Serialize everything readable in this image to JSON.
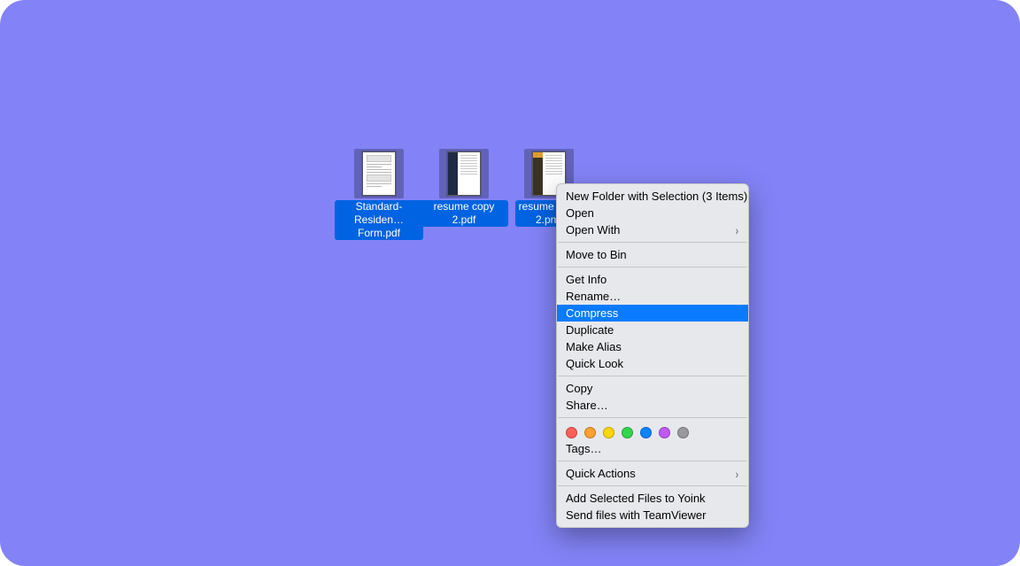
{
  "files": [
    {
      "label": "Standard-\nResiden…Form.pdf",
      "style": "form"
    },
    {
      "label": "resume copy 2.pdf",
      "style": "resume-blue"
    },
    {
      "label": "resume copy\n2.png",
      "style": "resume-orange"
    }
  ],
  "menu": {
    "highlighted": "compress",
    "items": {
      "new_folder_with_selection": "New Folder with Selection (3 Items)",
      "open": "Open",
      "open_with": "Open With",
      "move_to_bin": "Move to Bin",
      "get_info": "Get Info",
      "rename": "Rename…",
      "compress": "Compress",
      "duplicate": "Duplicate",
      "make_alias": "Make Alias",
      "quick_look": "Quick Look",
      "copy": "Copy",
      "share": "Share…",
      "tags": "Tags…",
      "quick_actions": "Quick Actions",
      "add_to_yoink": "Add Selected Files to Yoink",
      "send_with_teamviewer": "Send files with TeamViewer"
    },
    "tag_colors": [
      "#ff5f57",
      "#ffa030",
      "#ffd60a",
      "#32d74b",
      "#0a84ff",
      "#bf5af2",
      "#98989d"
    ]
  }
}
